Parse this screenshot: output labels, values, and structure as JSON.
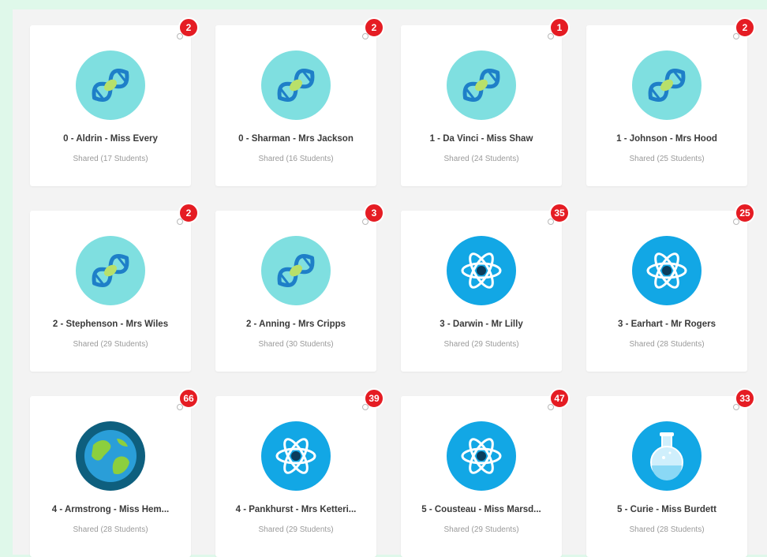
{
  "colors": {
    "badge": "#e51c23",
    "dna_bg": "#7fdfe0",
    "atom_bg": "#12a7e5",
    "earth_bg": "#0e5f7e",
    "flask_bg": "#12a7e5"
  },
  "classes": [
    {
      "title": "0 - Aldrin - Miss Every",
      "subtitle": "Shared (17 Students)",
      "badge": "2",
      "icon": "dna-icon"
    },
    {
      "title": "0 - Sharman - Mrs Jackson",
      "subtitle": "Shared (16 Students)",
      "badge": "2",
      "icon": "dna-icon"
    },
    {
      "title": "1 - Da Vinci - Miss Shaw",
      "subtitle": "Shared (24 Students)",
      "badge": "1",
      "icon": "dna-icon"
    },
    {
      "title": "1 - Johnson - Mrs Hood",
      "subtitle": "Shared (25 Students)",
      "badge": "2",
      "icon": "dna-icon"
    },
    {
      "title": "2 - Stephenson - Mrs Wiles",
      "subtitle": "Shared (29 Students)",
      "badge": "2",
      "icon": "dna-icon"
    },
    {
      "title": "2 - Anning - Mrs Cripps",
      "subtitle": "Shared (30 Students)",
      "badge": "3",
      "icon": "dna-icon"
    },
    {
      "title": "3 - Darwin - Mr Lilly",
      "subtitle": "Shared (29 Students)",
      "badge": "35",
      "icon": "atom-icon"
    },
    {
      "title": "3 - Earhart - Mr Rogers",
      "subtitle": "Shared (28 Students)",
      "badge": "25",
      "icon": "atom-icon"
    },
    {
      "title": "4 - Armstrong - Miss Hem...",
      "subtitle": "Shared (28 Students)",
      "badge": "66",
      "icon": "earth-icon"
    },
    {
      "title": "4 - Pankhurst - Mrs Ketteri...",
      "subtitle": "Shared (29 Students)",
      "badge": "39",
      "icon": "atom-icon"
    },
    {
      "title": "5 - Cousteau - Miss Marsd...",
      "subtitle": "Shared (29 Students)",
      "badge": "47",
      "icon": "atom-icon"
    },
    {
      "title": "5 - Curie - Miss Burdett",
      "subtitle": "Shared (28 Students)",
      "badge": "33",
      "icon": "flask-icon"
    }
  ]
}
